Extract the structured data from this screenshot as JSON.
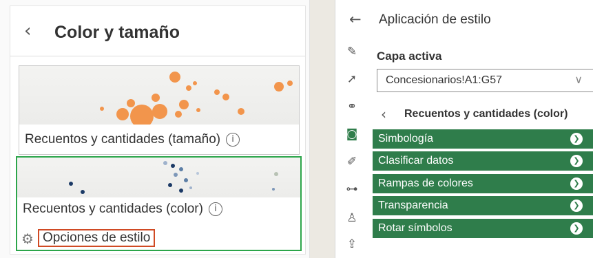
{
  "left_panel": {
    "title": "Color y tamaño",
    "cards": [
      {
        "label": "Recuentos y cantidades (tamaño)"
      },
      {
        "label": "Recuentos y cantidades (color)",
        "style_options": "Opciones de estilo"
      }
    ]
  },
  "right_panel": {
    "title": "Aplicación de estilo",
    "active_layer_label": "Capa activa",
    "active_layer_value": "Concesionarios!A1:G57",
    "sub_title": "Recuentos y cantidades (color)",
    "sections": [
      {
        "label": "Simbología"
      },
      {
        "label": "Clasificar datos"
      },
      {
        "label": "Rampas de colores"
      },
      {
        "label": "Transparencia"
      },
      {
        "label": "Rotar símbolos"
      }
    ],
    "accent_color": "#2f7d4b",
    "icons": [
      "styling-icon",
      "select-icon",
      "analysis-icon",
      "layers-icon",
      "edit-icon",
      "route-icon",
      "people-icon",
      "share-icon"
    ]
  }
}
